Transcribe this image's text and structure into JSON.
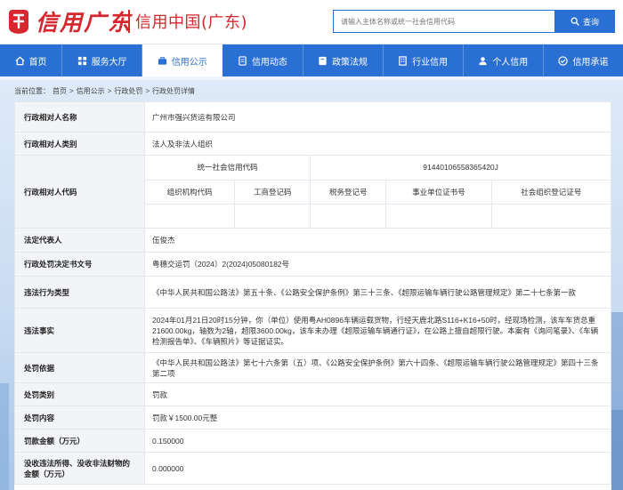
{
  "header": {
    "logo_script": "信用广东",
    "site_title": "信用中国(广东)",
    "search_placeholder": "请输入主体名称或统一社会信用代码",
    "search_button": "查询"
  },
  "nav": {
    "items": [
      {
        "label": "首页",
        "icon": "home-icon"
      },
      {
        "label": "服务大厅",
        "icon": "grid-icon"
      },
      {
        "label": "信用公示",
        "icon": "briefcase-icon",
        "active": true
      },
      {
        "label": "信用动态",
        "icon": "document-icon"
      },
      {
        "label": "政策法规",
        "icon": "book-icon"
      },
      {
        "label": "行业信用",
        "icon": "building-icon"
      },
      {
        "label": "个人信用",
        "icon": "user-icon"
      },
      {
        "label": "信用承诺",
        "icon": "handshake-icon"
      }
    ]
  },
  "breadcrumb": {
    "prefix": "当前位置：",
    "crumbs": [
      "首页",
      "信用公示",
      "行政处罚",
      "行政处罚详情"
    ],
    "separator": ">"
  },
  "record": {
    "rows": [
      {
        "label": "行政相对人名称",
        "value": "广州市强兴货运有限公司"
      },
      {
        "label": "行政相对人类别",
        "value": "法人及非法人组织"
      }
    ],
    "code_label": "行政相对人代码",
    "uscc_label": "统一社会信用代码",
    "uscc_value": "91440106558365420J",
    "code_headers": [
      "组织机构代码",
      "工商登记码",
      "税务登记号",
      "事业单位证书号",
      "社会组织登记证号"
    ],
    "code_values": [
      "",
      "",
      "",
      "",
      ""
    ],
    "rows2": [
      {
        "label": "法定代表人",
        "value": "伍俊杰"
      },
      {
        "label": "行政处罚决定书文号",
        "value": "粤穗交运罚〔2024〕2(2024)05080182号"
      },
      {
        "label": "违法行为类型",
        "value": "《中华人民共和国公路法》第五十条、《公路安全保护条例》第三十三条、《超限运输车辆行驶公路管理规定》第二十七条第一款"
      },
      {
        "label": "违法事实",
        "value": "2024年01月21日20时15分钟，你（单位）使用粤AH0896车辆运载货物，行经天鹿北路S116+K16+50时，经现场检测，该车车货总重21600.00kg，轴数为2轴，超限3600.00kg，该车未办理《超限运输车辆通行证》，在公路上擅自超限行驶。本案有《询问笔录》、《车辆检测报告单》、《车辆照片》等证据证实。"
      },
      {
        "label": "处罚依据",
        "value": "《中华人民共和国公路法》第七十六条第（五）项、《公路安全保护条例》第六十四条、《超限运输车辆行驶公路管理规定》第四十三条第二项"
      },
      {
        "label": "处罚类别",
        "value": "罚款"
      },
      {
        "label": "处罚内容",
        "value": "罚款￥1500.00元整"
      },
      {
        "label": "罚款金额（万元）",
        "value": "0.150000"
      },
      {
        "label": "没收违法所得、没收非法财物的金额（万元）",
        "value": "0.000000"
      }
    ]
  },
  "colors": {
    "brand_red": "#d6262e",
    "nav_blue": "#2a6fd3",
    "label_bg": "#f2f4f7"
  }
}
